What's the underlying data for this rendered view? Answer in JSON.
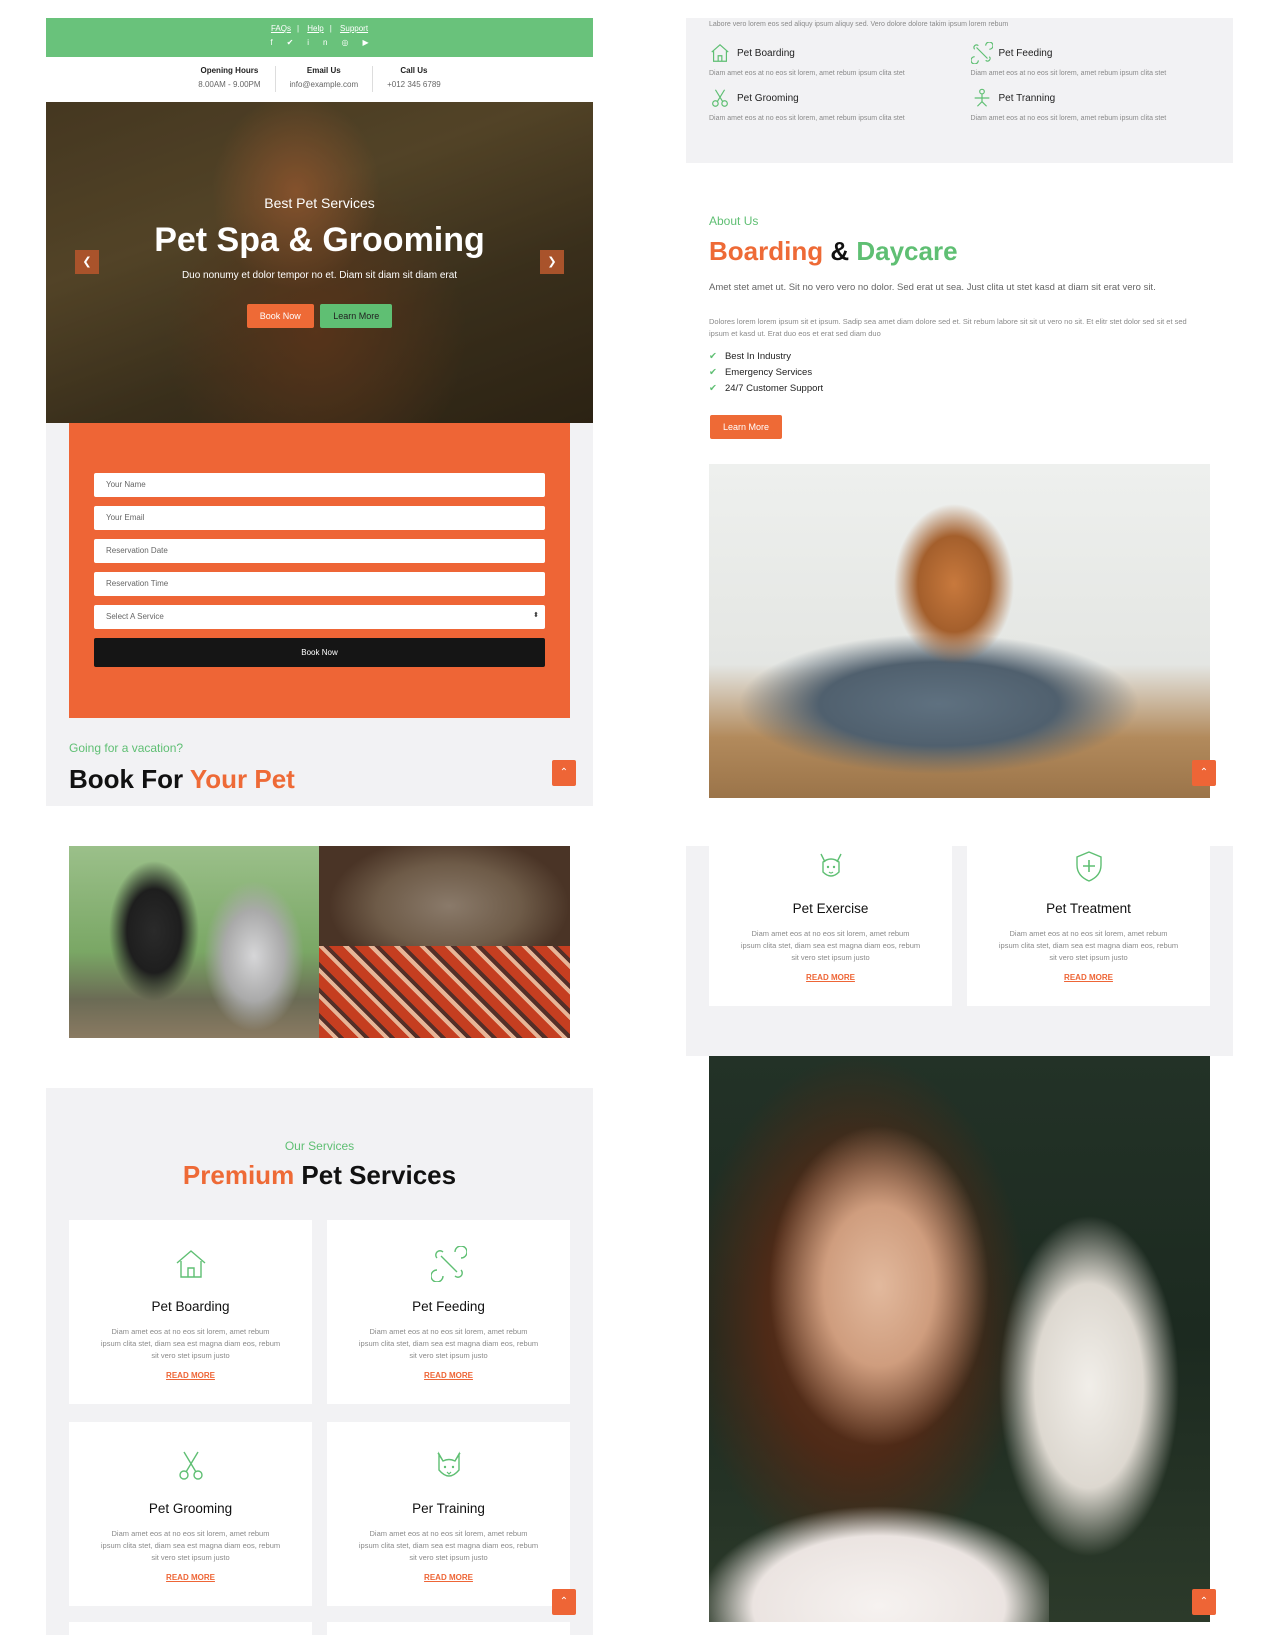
{
  "hero_panel": {
    "topbar": {
      "links": [
        "FAQs",
        "Help",
        "Support"
      ],
      "social_icons": [
        "facebook-icon",
        "twitter-icon",
        "linkedin-icon",
        "instagram-icon",
        "youtube-icon"
      ]
    },
    "contact": [
      {
        "label": "Opening Hours",
        "value": "8.00AM - 9.00PM"
      },
      {
        "label": "Email Us",
        "value": "info@example.com"
      },
      {
        "label": "Call Us",
        "value": "+012 345 6789"
      }
    ],
    "hero": {
      "subtitle": "Best Pet Services",
      "title": "Pet Spa & Grooming",
      "description": "Duo nonumy et dolor tempor no et. Diam sit diam sit diam erat",
      "book_button": "Book Now",
      "learn_button": "Learn More"
    },
    "booking_form": {
      "name_placeholder": "Your Name",
      "email_placeholder": "Your Email",
      "date_placeholder": "Reservation Date",
      "time_placeholder": "Reservation Time",
      "service_select": "Select A Service",
      "submit": "Book Now"
    },
    "vacation_sub": "Going for a vacation?",
    "book_title_a": "Book For ",
    "book_title_b": "Your Pet"
  },
  "about_panel": {
    "strip_text": "Labore vero lorem eos sed aliquy ipsum aliquy sed. Vero dolore dolore takim ipsum lorem rebum",
    "strip_items": [
      {
        "title": "Pet Boarding",
        "body": "Diam amet eos at no eos sit lorem, amet rebum ipsum clita stet",
        "icon": "house-icon"
      },
      {
        "title": "Pet Feeding",
        "body": "Diam amet eos at no eos sit lorem, amet rebum ipsum clita stet",
        "icon": "bone-icon"
      },
      {
        "title": "Pet Grooming",
        "body": "Diam amet eos at no eos sit lorem, amet rebum ipsum clita stet",
        "icon": "scissors-icon"
      },
      {
        "title": "Pet Tranning",
        "body": "Diam amet eos at no eos sit lorem, amet rebum ipsum clita stet",
        "icon": "training-icon"
      }
    ],
    "sub": "About Us",
    "title_a": "Boarding",
    "title_amp": " & ",
    "title_b": "Daycare",
    "lead": "Amet stet amet ut. Sit no vero vero no dolor. Sed erat ut sea. Just clita ut stet kasd at diam sit erat vero sit.",
    "body": "Dolores lorem lorem ipsum sit et ipsum. Sadip sea amet diam dolore sed et. Sit rebum labore sit sit ut vero no sit. Et elitr stet dolor sed sit et sed ipsum et kasd ut. Erat duo eos et erat sed diam duo",
    "checks": [
      "Best In Industry",
      "Emergency Services",
      "24/7 Customer Support"
    ],
    "button": "Learn More"
  },
  "cards_top": [
    {
      "title": "Pet Exercise",
      "body": "Diam amet eos at no eos sit lorem, amet rebum ipsum clita stet, diam sea est magna diam eos, rebum sit vero stet ipsum justo",
      "more": "READ MORE",
      "icon": "dog-face-icon"
    },
    {
      "title": "Pet Treatment",
      "body": "Diam amet eos at no eos sit lorem, amet rebum ipsum clita stet, diam sea est magna diam eos, rebum sit vero stet ipsum justo",
      "more": "READ MORE",
      "icon": "shield-cross-icon"
    }
  ],
  "services_panel": {
    "sub": "Our Services",
    "title_a": "Premium",
    "title_b": " Pet Services",
    "cards": [
      {
        "title": "Pet Boarding",
        "body": "Diam amet eos at no eos sit lorem, amet rebum ipsum clita stet, diam sea est magna diam eos, rebum sit vero stet ipsum justo",
        "more": "READ MORE",
        "icon": "house-icon"
      },
      {
        "title": "Pet Feeding",
        "body": "Diam amet eos at no eos sit lorem, amet rebum ipsum clita stet, diam sea est magna diam eos, rebum sit vero stet ipsum justo",
        "more": "READ MORE",
        "icon": "bone-icon"
      },
      {
        "title": "Pet Grooming",
        "body": "Diam amet eos at no eos sit lorem, amet rebum ipsum clita stet, diam sea est magna diam eos, rebum sit vero stet ipsum justo",
        "more": "READ MORE",
        "icon": "scissors-icon"
      },
      {
        "title": "Per Training",
        "body": "Diam amet eos at no eos sit lorem, amet rebum ipsum clita stet, diam sea est magna diam eos, rebum sit vero stet ipsum justo",
        "more": "READ MORE",
        "icon": "cat-face-icon"
      }
    ]
  },
  "colors": {
    "brand_green": "#5fbf73",
    "brand_orange": "#ee6536",
    "dark": "#111111",
    "panel_bg": "#f2f2f4"
  }
}
